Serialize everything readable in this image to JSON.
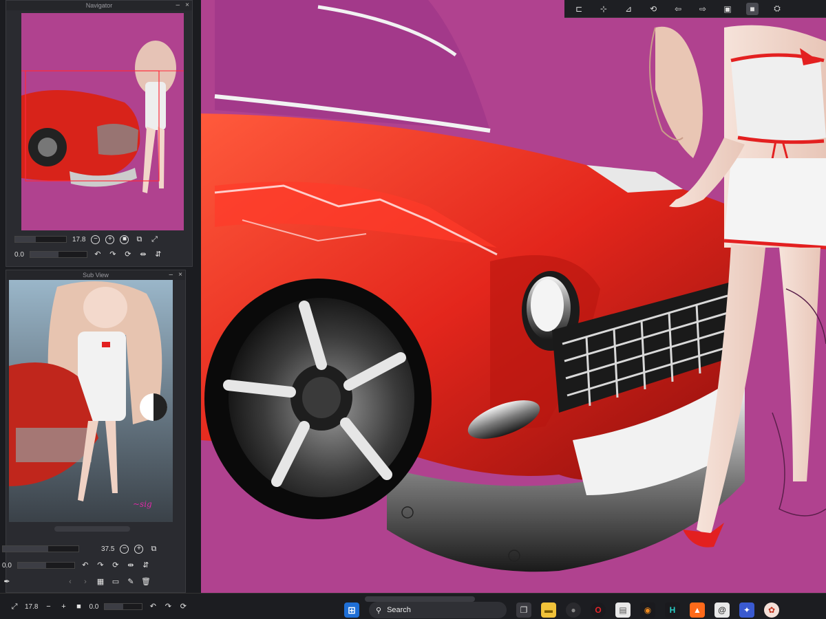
{
  "navigator": {
    "title": "Navigator",
    "zoom": "17.8",
    "rotation": "0.0"
  },
  "subview": {
    "title": "Sub View",
    "zoom": "37.5",
    "rotation": "0.0"
  },
  "status_bar": {
    "zoom": "17.8",
    "rotation": "0.0"
  },
  "taskbar": {
    "search_label": "Search"
  },
  "icons": {
    "window_close": "×",
    "window_min": "–",
    "zoom_out": "−",
    "zoom_in": "+",
    "fit": "■",
    "rotate_left": "↶",
    "rotate_right": "↷",
    "reset_rotate": "⟳",
    "flip_h": "⇹",
    "flip_v": "⇵",
    "grid": "▦",
    "folder": "▭",
    "edit": "✎",
    "trash": "🗑",
    "eyedropper": "✒"
  },
  "colors": {
    "canvas_bg": "#b0428f",
    "car_red": "#e3261c",
    "panel_bg": "#2a2b30"
  }
}
